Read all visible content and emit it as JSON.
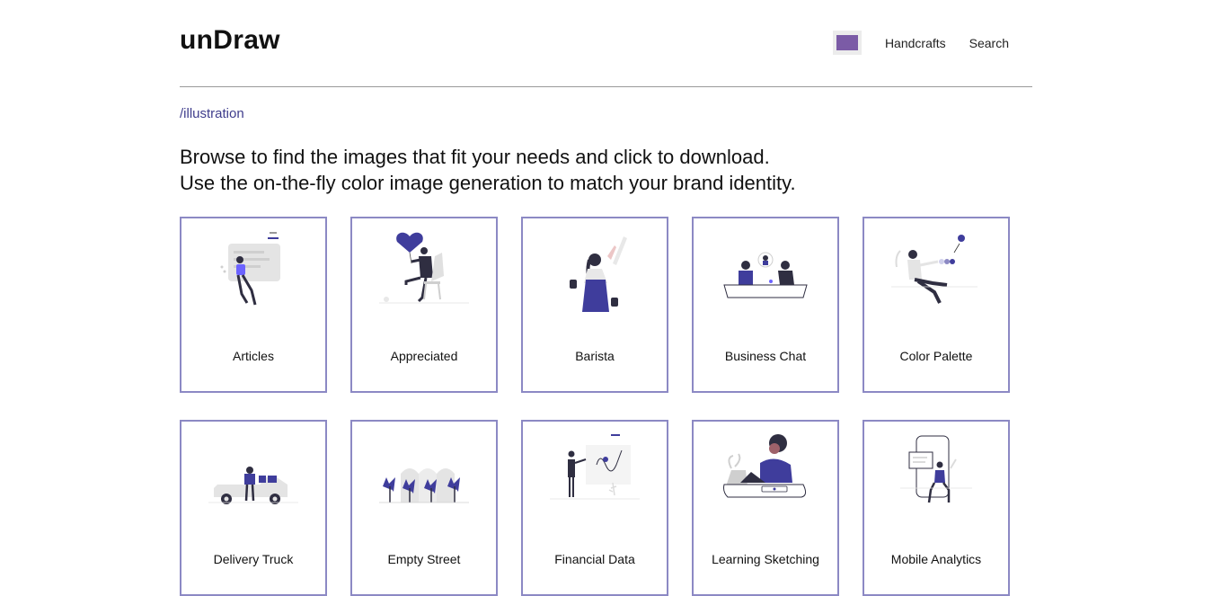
{
  "header": {
    "logo": "unDraw",
    "color_swatch": {
      "color": "#7b5ba6"
    },
    "nav": [
      "Handcrafts",
      "Search"
    ]
  },
  "breadcrumb": "/illustration",
  "intro": {
    "line1": "Browse to find the images that fit your needs and click to download.",
    "line2": "Use the on-the-fly color image generation to match your brand identity."
  },
  "colors": {
    "accent": "#3f3d9c",
    "card_border": "#8c89c4",
    "breadcrumb": "#3f3d8c"
  },
  "illustrations": [
    {
      "label": "Articles",
      "icon": "articles-illustration"
    },
    {
      "label": "Appreciated",
      "icon": "appreciated-illustration"
    },
    {
      "label": "Barista",
      "icon": "barista-illustration"
    },
    {
      "label": "Business Chat",
      "icon": "business-chat-illustration"
    },
    {
      "label": "Color Palette",
      "icon": "color-palette-illustration"
    },
    {
      "label": "Delivery Truck",
      "icon": "delivery-truck-illustration"
    },
    {
      "label": "Empty Street",
      "icon": "empty-street-illustration"
    },
    {
      "label": "Financial Data",
      "icon": "financial-data-illustration"
    },
    {
      "label": "Learning Sketching",
      "icon": "learning-sketching-illustration"
    },
    {
      "label": "Mobile Analytics",
      "icon": "mobile-analytics-illustration"
    }
  ]
}
